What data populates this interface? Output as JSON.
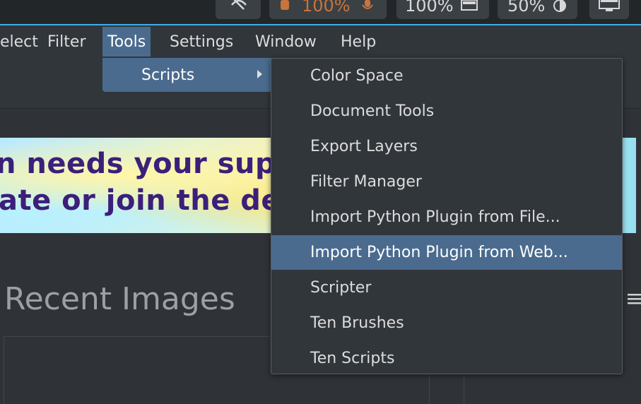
{
  "statusbar": {
    "zoom_value": "100%",
    "rotation_value": "100%",
    "opacity_value": "50%"
  },
  "menubar": {
    "select": "elect",
    "filter": "Filter",
    "tools": "Tools",
    "settings": "Settings",
    "window": "Window",
    "help": "Help"
  },
  "tools_menu": {
    "scripts": "Scripts"
  },
  "scripts_submenu": {
    "items": [
      "Color Space",
      "Document Tools",
      "Export Layers",
      "Filter Manager",
      "Import Python Plugin from File...",
      "Import Python Plugin from Web...",
      "Scripter",
      "Ten Brushes",
      "Ten Scripts"
    ],
    "highlighted_index": 5
  },
  "banner": {
    "line1": "n needs your sup",
    "line2": "ate or join the de"
  },
  "welcome": {
    "recent_images_title": "Recent Images"
  },
  "colors": {
    "accent": "#3daee9",
    "highlight": "#4a6b8e",
    "status_orange": "#c8743c"
  }
}
